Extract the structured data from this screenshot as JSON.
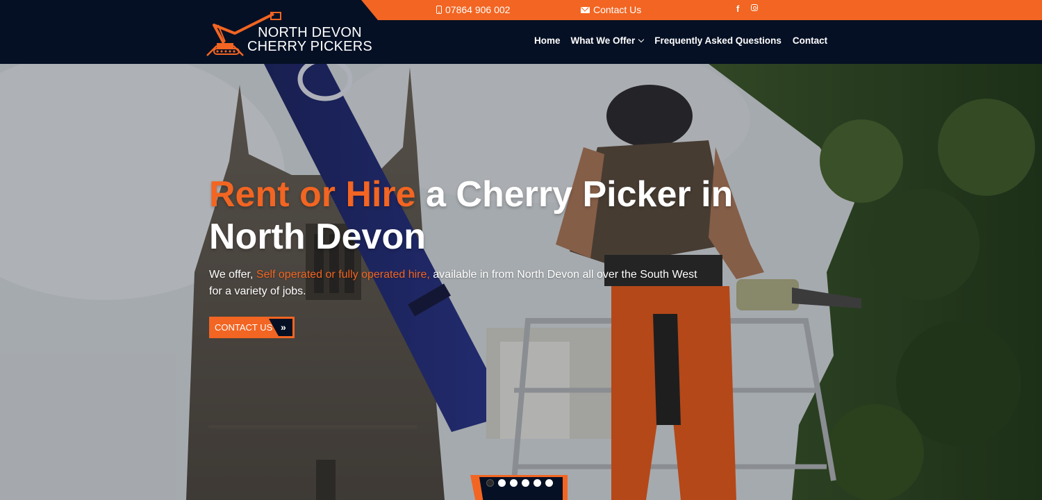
{
  "topbar": {
    "phone": "07864 906 002",
    "email_label": "Contact Us",
    "social": [
      "facebook-icon",
      "instagram-icon"
    ],
    "accent": "#f26522"
  },
  "logo": {
    "line1": "NORTH DEVON",
    "line2": "CHERRY PICKERS"
  },
  "nav": {
    "home": "Home",
    "offer": "What We Offer",
    "faq": "Frequently Asked Questions",
    "contact": "Contact"
  },
  "hero": {
    "title_highlight": "Rent or Hire",
    "title_rest": " a Cherry Picker in North Devon",
    "sub_prefix": "We offer, ",
    "sub_highlight": "Self operated or fully operated hire,",
    "sub_rest": " available in from North Devon all over the South West for a variety of jobs.",
    "cta_label": "CONTACT US",
    "slides": 6,
    "active_slide": 1
  },
  "colors": {
    "navy": "#061024",
    "orange": "#f26522"
  }
}
